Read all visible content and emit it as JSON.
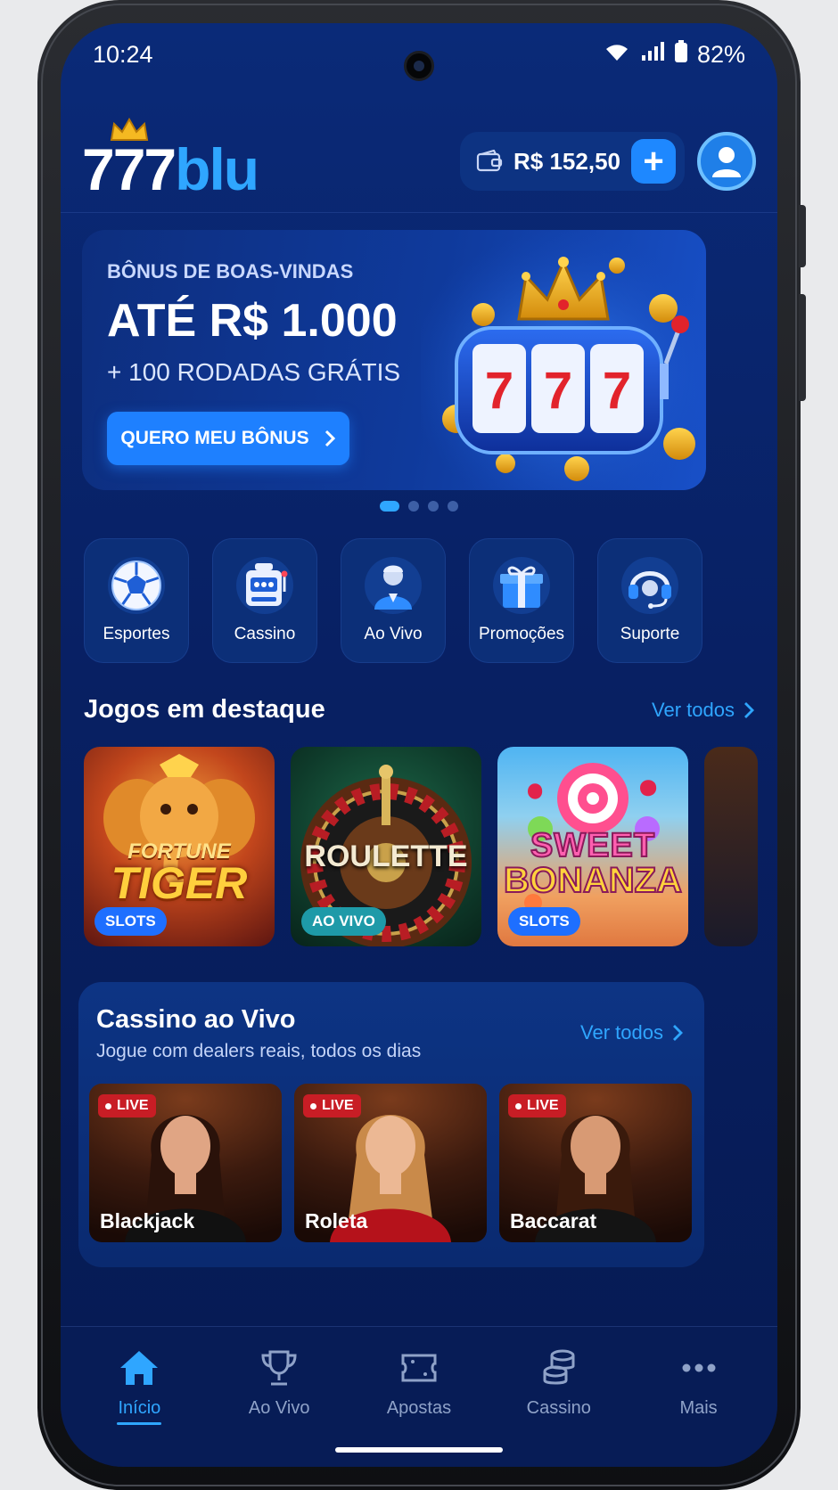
{
  "status": {
    "time": "10:24",
    "battery": "82%"
  },
  "header": {
    "logo_main": "777",
    "logo_accent": "blu",
    "balance": "R$ 152,50"
  },
  "banner": {
    "kicker": "BÔNUS DE BOAS-VINDAS",
    "headline": "ATÉ R$ 1.000",
    "subline": "+ 100 RODADAS GRÁTIS",
    "cta_label": "QUERO MEU BÔNUS",
    "slot_reels": [
      "7",
      "7",
      "7"
    ],
    "carousel_count": 4,
    "carousel_active": 0
  },
  "categories": [
    {
      "label": "Esportes",
      "icon": "soccer-ball-icon"
    },
    {
      "label": "Cassino",
      "icon": "slot-machine-icon"
    },
    {
      "label": "Ao Vivo",
      "icon": "dealer-icon"
    },
    {
      "label": "Promoções",
      "icon": "gift-icon"
    },
    {
      "label": "Suporte",
      "icon": "headset-icon"
    }
  ],
  "featured": {
    "title": "Jogos em destaque",
    "link": "Ver todos",
    "games": [
      {
        "name_line1": "FORTUNE",
        "name_line2": "TIGER",
        "tag": "SLOTS"
      },
      {
        "name_line1": "ROULETTE",
        "name_line2": "",
        "tag": "AO VIVO"
      },
      {
        "name_line1": "SWEET",
        "name_line2": "BONANZA",
        "tag": "SLOTS"
      }
    ]
  },
  "live": {
    "title": "Cassino ao Vivo",
    "subtitle": "Jogue com dealers reais, todos os dias",
    "link": "Ver todos",
    "badge": "LIVE",
    "tables": [
      "Blackjack",
      "Roleta",
      "Baccarat"
    ]
  },
  "nav": [
    {
      "label": "Início",
      "icon": "home-icon",
      "active": true
    },
    {
      "label": "Ao Vivo",
      "icon": "trophy-icon",
      "active": false
    },
    {
      "label": "Apostas",
      "icon": "ticket-icon",
      "active": false
    },
    {
      "label": "Cassino",
      "icon": "coins-icon",
      "active": false
    },
    {
      "label": "Mais",
      "icon": "more-icon",
      "active": false
    }
  ],
  "colors": {
    "accent": "#2fa6ff",
    "button": "#1e80ff",
    "background": "#082063",
    "live": "#c81d25"
  }
}
